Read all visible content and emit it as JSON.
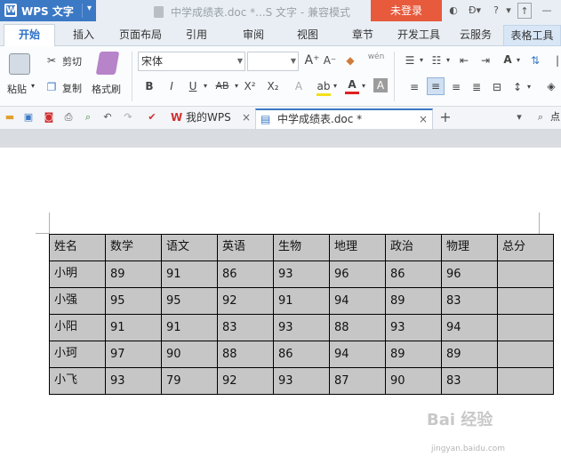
{
  "app": {
    "name": "WPS 文字",
    "logo_letter": "W"
  },
  "window_title": "中学成绩表.doc *...S 文字 - 兼容模式",
  "login_label": "未登录",
  "title_controls": [
    "?",
    "·"
  ],
  "menu_tabs": [
    "开始",
    "插入",
    "页面布局",
    "引用",
    "审阅",
    "视图",
    "章节",
    "开发工具",
    "云服务",
    "表格工具"
  ],
  "ribbon": {
    "paste_label": "粘贴",
    "cut_label": "剪切",
    "copy_label": "复制",
    "format_painter_label": "格式刷",
    "font_name": "宋体",
    "font_size": "",
    "format_buttons": [
      "B",
      "I",
      "U",
      "AB",
      "X²",
      "X₂"
    ],
    "font_color_label": "A",
    "highlight_label": "ab",
    "wen_label": "wén"
  },
  "doc_tabs": [
    {
      "label": "我的WPS"
    },
    {
      "label": "中学成绩表.doc *"
    }
  ],
  "right_search_label": "点",
  "table": {
    "headers": [
      "姓名",
      "数学",
      "语文",
      "英语",
      "生物",
      "地理",
      "政治",
      "物理",
      "总分"
    ],
    "rows": [
      [
        "小明",
        "89",
        "91",
        "86",
        "93",
        "96",
        "86",
        "96",
        ""
      ],
      [
        "小强",
        "95",
        "95",
        "92",
        "91",
        "94",
        "89",
        "83",
        ""
      ],
      [
        "小阳",
        "91",
        "91",
        "83",
        "93",
        "88",
        "93",
        "94",
        ""
      ],
      [
        "小珂",
        "97",
        "90",
        "88",
        "86",
        "94",
        "89",
        "89",
        ""
      ],
      [
        "小飞",
        "93",
        "79",
        "92",
        "93",
        "87",
        "90",
        "83",
        ""
      ]
    ]
  },
  "watermark": {
    "text": "Bai 经验",
    "url": "jingyan.baidu.com"
  },
  "colors": {
    "app_blue": "#3b79c5",
    "login_red": "#e75a3c",
    "cell_gray": "#c6c6c6"
  }
}
